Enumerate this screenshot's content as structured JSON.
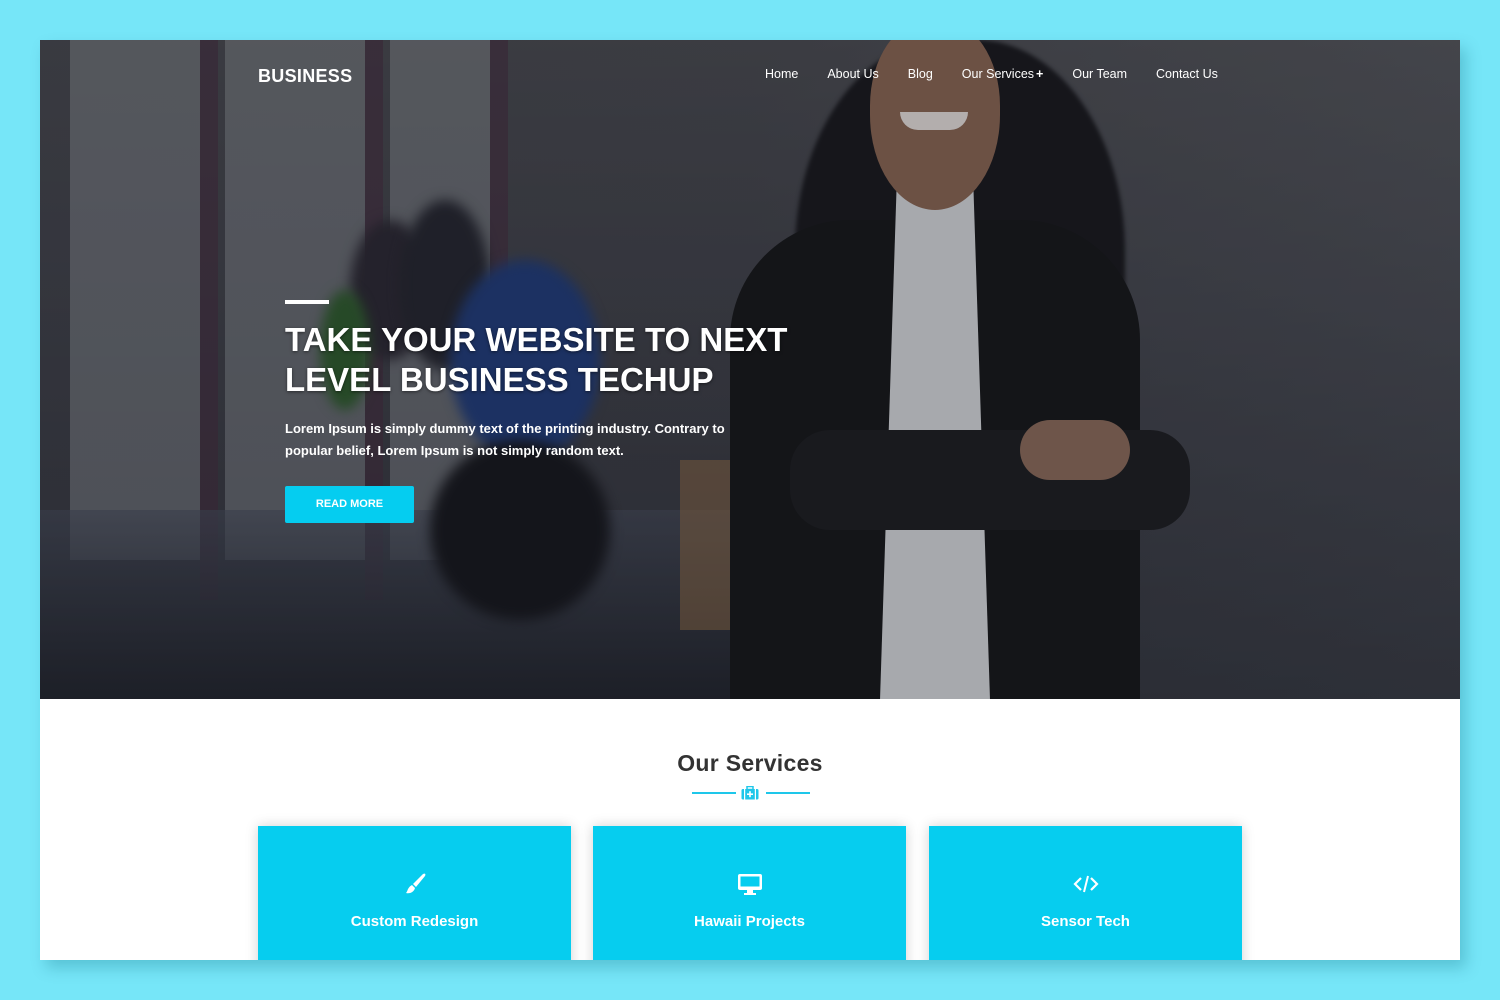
{
  "colors": {
    "page_background": "#76e6f8",
    "accent": "#06cdef",
    "heading": "#333333"
  },
  "header": {
    "brand": "BUSINESS",
    "nav": [
      {
        "label": "Home"
      },
      {
        "label": "About Us"
      },
      {
        "label": "Blog"
      },
      {
        "label": "Our Services",
        "suffix": "+"
      },
      {
        "label": "Our Team"
      },
      {
        "label": "Contact Us"
      }
    ]
  },
  "hero": {
    "title_line1": "TAKE YOUR WEBSITE TO NEXT",
    "title_line2": "LEVEL BUSINESS TECHUP",
    "text": "Lorem Ipsum is simply dummy text of the printing industry. Contrary to popular belief, Lorem Ipsum is not simply random text.",
    "button_label": "READ MORE"
  },
  "services": {
    "title": "Our Services",
    "divider_icon": "medkit-icon",
    "cards": [
      {
        "icon": "paint-brush-icon",
        "label": "Custom Redesign"
      },
      {
        "icon": "desktop-icon",
        "label": "Hawaii Projects"
      },
      {
        "icon": "code-icon",
        "label": "Sensor Tech"
      }
    ]
  }
}
